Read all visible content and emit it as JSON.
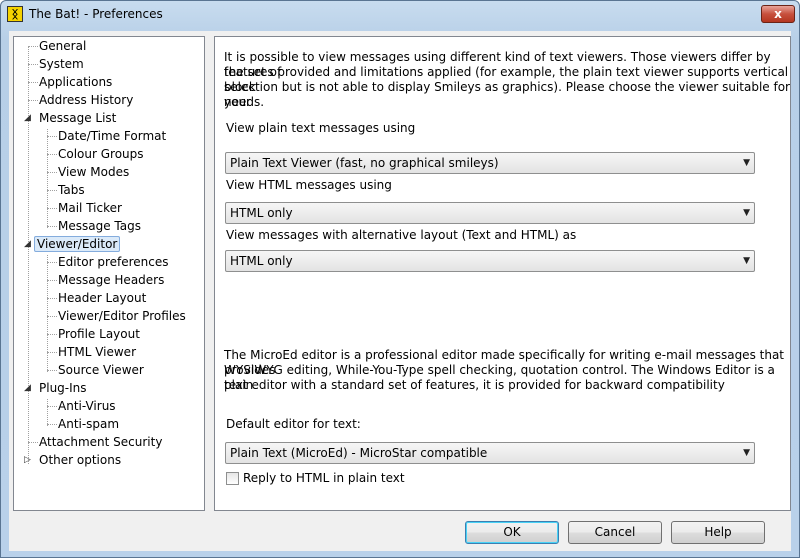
{
  "window": {
    "title": "The Bat! - Preferences",
    "close_label": "x",
    "app_icon_glyph": "ᛝ"
  },
  "tree": {
    "items": [
      {
        "label": "General",
        "level": 0
      },
      {
        "label": "System",
        "level": 0
      },
      {
        "label": "Applications",
        "level": 0
      },
      {
        "label": "Address History",
        "level": 0
      },
      {
        "label": "Message List",
        "level": 0,
        "expanded": true
      },
      {
        "label": "Date/Time Format",
        "level": 1
      },
      {
        "label": "Colour Groups",
        "level": 1
      },
      {
        "label": "View Modes",
        "level": 1
      },
      {
        "label": "Tabs",
        "level": 1
      },
      {
        "label": "Mail Ticker",
        "level": 1
      },
      {
        "label": "Message Tags",
        "level": 1
      },
      {
        "label": "Viewer/Editor",
        "level": 0,
        "expanded": true,
        "selected": true
      },
      {
        "label": "Editor preferences",
        "level": 1
      },
      {
        "label": "Message Headers",
        "level": 1
      },
      {
        "label": "Header Layout",
        "level": 1
      },
      {
        "label": "Viewer/Editor Profiles",
        "level": 1
      },
      {
        "label": "Profile Layout",
        "level": 1
      },
      {
        "label": "HTML Viewer",
        "level": 1
      },
      {
        "label": "Source Viewer",
        "level": 1
      },
      {
        "label": "Plug-Ins",
        "level": 0,
        "expanded": true
      },
      {
        "label": "Anti-Virus",
        "level": 1
      },
      {
        "label": "Anti-spam",
        "level": 1
      },
      {
        "label": "Attachment Security",
        "level": 0
      },
      {
        "label": "Other options",
        "level": 0,
        "collapsed": true
      }
    ]
  },
  "panel": {
    "intro_lines": [
      "It is possible to view messages using different kind of text viewers. Those viewers differ by the set of",
      "features provided and limitations applied (for example, the plain text viewer supports vertical block",
      "selection but is not able to display Smileys as graphics). Please choose the viewer suitable for your",
      "needs."
    ],
    "plain_label": "View plain text messages using",
    "plain_value": "Plain Text Viewer (fast, no graphical smileys)",
    "html_label": "View HTML messages using",
    "html_value": "HTML only",
    "alt_label": "View messages with alternative layout (Text and HTML) as",
    "alt_value": "HTML only",
    "editor_lines": [
      "The MicroEd editor is a professional editor made specifically for writing e-mail messages that provides",
      "WYSIWYG editing, While-You-Type spell checking, quotation control. The Windows Editor is a plain",
      "text editor with a standard set of features, it is provided for backward compatibility"
    ],
    "default_editor_label": "Default editor for text:",
    "default_editor_value": "Plain Text (MicroEd)  - MicroStar compatible",
    "reply_checkbox_label": "Reply to HTML in plain text",
    "reply_checked": false
  },
  "buttons": {
    "ok": "OK",
    "cancel": "Cancel",
    "help": "Help"
  }
}
